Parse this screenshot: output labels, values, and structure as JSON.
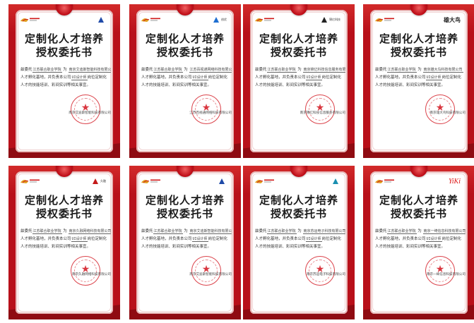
{
  "document": {
    "title_line1": "定制化人才培养",
    "title_line2": "授权委托书",
    "line2": "人才孵化基地，并负责本公司",
    "line2_tail": "岗位定制化",
    "line3": "人才的技能培训、彩间实训等相关事宜。",
    "prefix": "兹委托",
    "school": "江苏联合职业学院",
    "verb": "为",
    "position": "UI设计师"
  },
  "certificates": [
    {
      "partner_logo_text": "",
      "partner_logo_style": "vertical-blue",
      "company_handwritten": "南京艾迪斯智能科技有限公司",
      "signer": "南京艾迪斯智能科技有限公司"
    },
    {
      "partner_logo_text": "创优",
      "partner_logo_style": "blue-mark",
      "company_handwritten": "江苏百视通网络科技有限公司",
      "signer": "江苏百视通网络科技有限公司"
    },
    {
      "partner_logo_text": "锦亿科技",
      "partner_logo_style": "dark-mark",
      "company_handwritten": "南京锦亿科技信息服务有限公司",
      "signer": "南京锦亿科技信息服务有限公司"
    },
    {
      "partner_logo_text": "雄大鸟",
      "partner_logo_style": "calligraphy",
      "company_handwritten": "南京雄大鸟科技有限公司",
      "signer": "南京雄大鸟科技有限公司"
    },
    {
      "partner_logo_text": "久融",
      "partner_logo_style": "red-mark",
      "company_handwritten": "南京久融网络科技有限公司",
      "signer": "南京久融网络科技有限公司"
    },
    {
      "partner_logo_text": "",
      "partner_logo_style": "vertical-blue",
      "company_handwritten": "南京艾迪斯智能科技有限公司",
      "signer": "南京艾迪斯智能科技有限公司"
    },
    {
      "partner_logo_text": "",
      "partner_logo_style": "teal-mark",
      "company_handwritten": "南京苏运电子科技有限公司",
      "signer": "南京苏运电子科技有限公司"
    },
    {
      "partner_logo_text": "YiKi",
      "partner_logo_style": "yiki",
      "company_handwritten": "南京一绮信息科技有限公司",
      "signer": "南京一绮信息科技有限公司"
    }
  ],
  "colors": {
    "background_red": "#b8101a",
    "stamp_red": "#d2141e",
    "title_text": "#1a1a1a"
  }
}
